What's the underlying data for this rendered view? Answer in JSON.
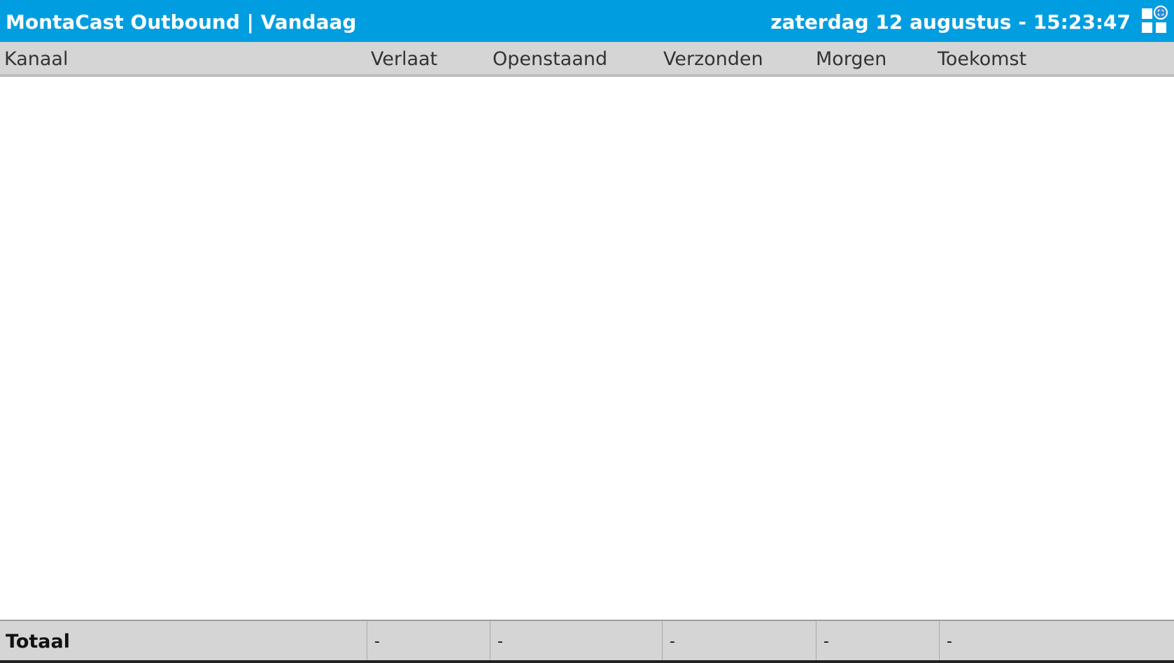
{
  "header": {
    "title": "MontaCast Outbound | Vandaag",
    "datetime": "zaterdag 12 augustus - 15:23:47",
    "icon": "dashboard-grid-icon"
  },
  "table": {
    "columns": [
      "Kanaal",
      "Verlaat",
      "Openstaand",
      "Verzonden",
      "Morgen",
      "Toekomst"
    ],
    "rows": []
  },
  "footer": {
    "label": "Totaal",
    "values": [
      "-",
      "-",
      "-",
      "-",
      "-"
    ]
  },
  "colors": {
    "topbar": "#009ee0",
    "header_bg": "#d5d5d5"
  }
}
